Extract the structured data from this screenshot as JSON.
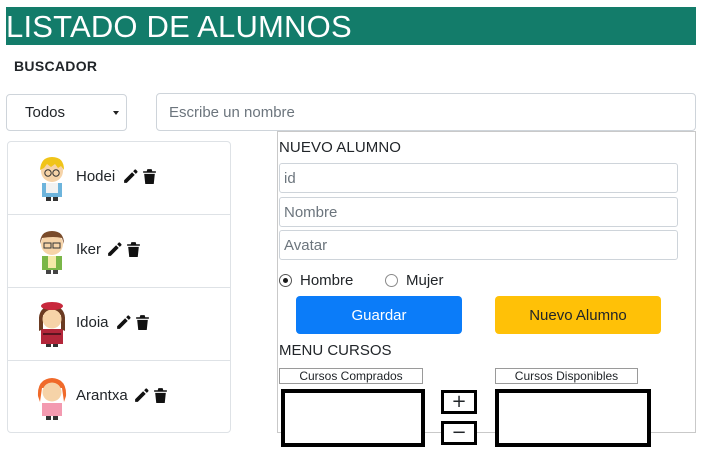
{
  "header": {
    "title": "LISTADO DE ALUMNOS"
  },
  "search": {
    "title": "BUSCADOR",
    "filter_selected": "Todos",
    "name_placeholder": "Escribe un nombre"
  },
  "students": [
    {
      "name": "Hodei"
    },
    {
      "name": "Iker"
    },
    {
      "name": "Idoia"
    },
    {
      "name": "Arantxa"
    }
  ],
  "form": {
    "title": "NUEVO ALUMNO",
    "id_placeholder": "id",
    "name_placeholder": "Nombre",
    "avatar_placeholder": "Avatar",
    "gender_male": "Hombre",
    "gender_female": "Mujer",
    "gender_selected": "Hombre",
    "save_label": "Guardar",
    "new_label": "Nuevo Alumno"
  },
  "courses": {
    "title": "MENU CURSOS",
    "bought_label": "Cursos Comprados",
    "available_label": "Cursos Disponibles",
    "add_label": "+",
    "remove_label": "−"
  },
  "colors": {
    "header_bg": "#137c6a",
    "primary": "#0b7cf9",
    "warning": "#ffc107"
  },
  "icons": [
    "pencil-icon",
    "trash-icon",
    "chevron-down-icon"
  ]
}
